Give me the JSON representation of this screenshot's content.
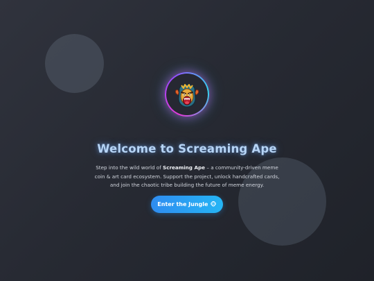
{
  "hero": {
    "title": "Welcome to Screaming Ape",
    "description": {
      "intro": "Step into the wild world of ",
      "brand": "Screaming Ape",
      "rest": " – a community-driven meme coin & art card ecosystem. Support the project, unlock handcrafted cards, and join the chaotic tribe building the future of meme energy."
    },
    "cta": {
      "label": "Enter the Jungle",
      "icon": "ape-face-icon",
      "icon_glyph": "🐵"
    },
    "logo": {
      "icon": "screaming-ape-logo-icon",
      "ring_colors": [
        "#e43bd8",
        "#9a49ff",
        "#33d6f0"
      ]
    }
  },
  "colors": {
    "background": "#272a33",
    "title_glow": "#b6d4f5",
    "accent": "#2f8cf0",
    "accent_secondary": "#25b5f5"
  }
}
